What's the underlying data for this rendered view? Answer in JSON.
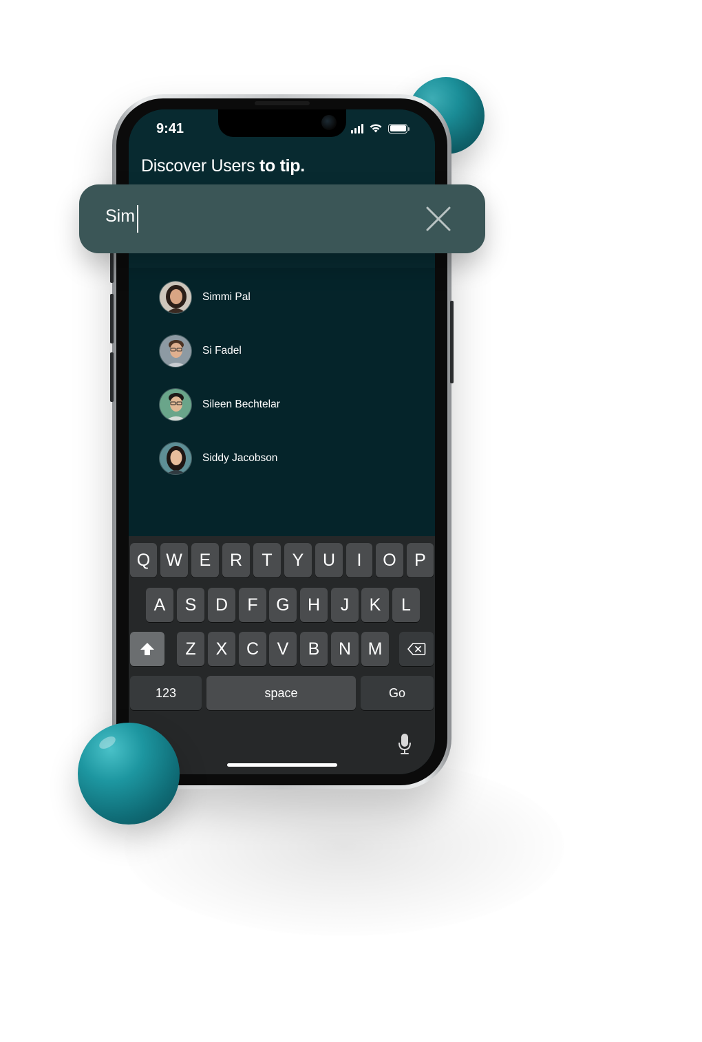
{
  "status_bar": {
    "time": "9:41",
    "signal_icon": "signal-bars-icon",
    "wifi_icon": "wifi-icon",
    "battery_icon": "battery-icon"
  },
  "header": {
    "title_regular": "Discover Users",
    "title_bold": " to tip."
  },
  "search": {
    "value": "Sim",
    "clear_icon": "close-icon"
  },
  "results": [
    {
      "name": "Simmi Pal",
      "avatar": "avatar-photo-woman-1"
    },
    {
      "name": "Si Fadel",
      "avatar": "avatar-photo-man-1"
    },
    {
      "name": "Sileen Bechtelar",
      "avatar": "avatar-photo-man-2"
    },
    {
      "name": "Siddy Jacobson",
      "avatar": "avatar-photo-woman-2"
    }
  ],
  "keyboard": {
    "row1": [
      "Q",
      "W",
      "E",
      "R",
      "T",
      "Y",
      "U",
      "I",
      "O",
      "P"
    ],
    "row2": [
      "A",
      "S",
      "D",
      "F",
      "G",
      "H",
      "J",
      "K",
      "L"
    ],
    "row3": [
      "Z",
      "X",
      "C",
      "V",
      "B",
      "N",
      "M"
    ],
    "shift_icon": "shift-icon",
    "delete_icon": "backspace-icon",
    "numbers_label": "123",
    "space_label": "space",
    "go_label": "Go",
    "mic_icon": "microphone-icon"
  },
  "colors": {
    "accent_teal": "#1d96a0",
    "screen_bg": "#05242a",
    "search_bg": "#3b5657"
  }
}
